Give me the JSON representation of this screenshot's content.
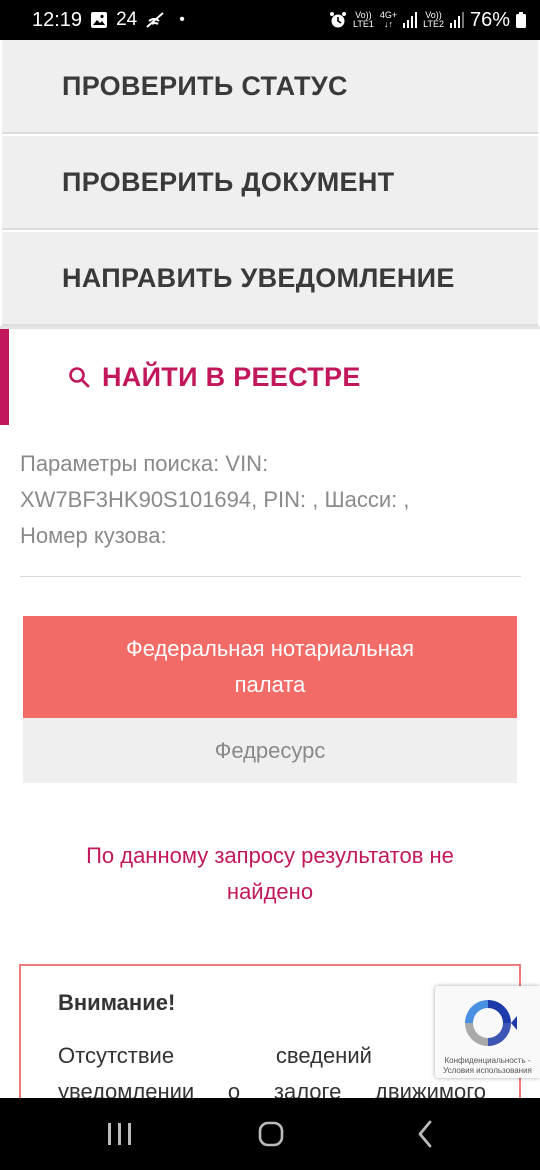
{
  "status_bar": {
    "time": "12:19",
    "notif_count": "24",
    "dot": "•",
    "sim1_label_top": "Vo))",
    "sim1_label_bottom": "LTE1",
    "net_label_top": "4G+",
    "net_label_bottom": "↓↑",
    "sim2_label_top": "Vo))",
    "sim2_label_bottom": "LTE2",
    "battery": "76%",
    "icons": [
      "gallery-icon",
      "wifi-calling-icon",
      "alarm-icon",
      "signal-icon",
      "battery-icon"
    ]
  },
  "menu": {
    "check_status": "ПРОВЕРИТЬ СТАТУС",
    "check_document": "ПРОВЕРИТЬ ДОКУМЕНТ",
    "send_notification": "НАПРАВИТЬ УВЕДОМЛЕНИЕ",
    "search_registry": "НАЙТИ В РЕЕСТРЕ"
  },
  "search": {
    "params_line1": "Параметры поиска: VIN:",
    "params_line2": "XW7BF3HK90S101694, PIN: , Шасси: ,",
    "params_line3": "Номер кузова:"
  },
  "tabs": {
    "fnp": "Федеральная нотариальная палата",
    "fedresurs": "Федресурс"
  },
  "result": {
    "message": "По данному запросу результатов не найдено"
  },
  "warning": {
    "title": "Внимание!",
    "line1": "Отсутствие сведений о",
    "line2": "уведомлении о залоге движимого"
  },
  "recaptcha": {
    "caption_line1": "Конфиденциальность -",
    "caption_line2": "Условия использования"
  },
  "colors": {
    "accent": "#c2185b",
    "tab_active": "#f26b66",
    "menu_bg": "#efefef"
  }
}
